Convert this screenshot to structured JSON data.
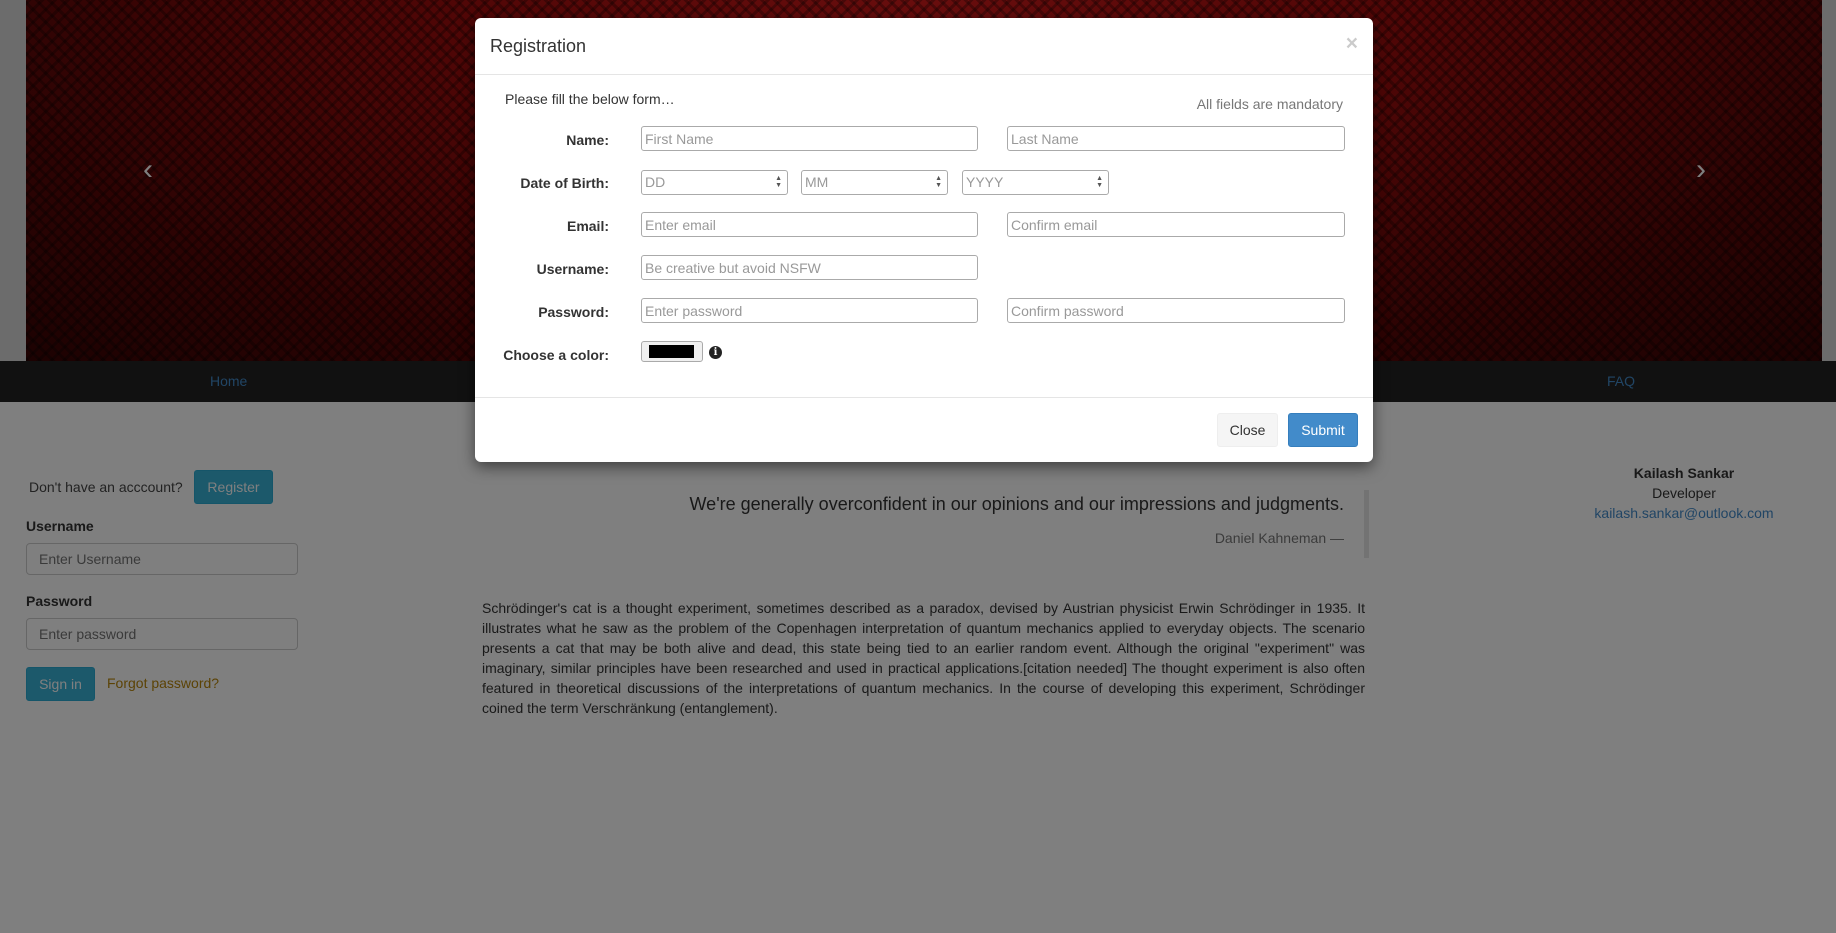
{
  "nav": {
    "home": "Home",
    "faq": "FAQ"
  },
  "carousel": {
    "prev_glyph": "‹",
    "next_glyph": "›"
  },
  "login": {
    "prompt": "Don't have an acccount?",
    "register_label": "Register",
    "username_label": "Username",
    "username_placeholder": "Enter Username",
    "password_label": "Password",
    "password_placeholder": "Enter password",
    "signin_label": "Sign in",
    "forgot_label": "Forgot password?"
  },
  "quote": {
    "text": "We're generally overconfident in our opinions and our impressions and judgments.",
    "author": "Daniel Kahneman —"
  },
  "article": "Schrödinger's cat is a thought experiment, sometimes described as a paradox, devised by Austrian physicist Erwin Schrödinger in 1935. It illustrates what he saw as the problem of the Copenhagen interpretation of quantum mechanics applied to everyday objects. The scenario presents a cat that may be both alive and dead, this state being tied to an earlier random event. Although the original \"experiment\" was imaginary, similar principles have been researched and used in practical applications.[citation needed] The thought experiment is also often featured in theoretical discussions of the interpretations of quantum mechanics. In the course of developing this experiment, Schrödinger coined the term Verschränkung (entanglement).",
  "contact": {
    "name": "Kailash Sankar",
    "role": "Developer",
    "email": "kailash.sankar@outlook.com"
  },
  "modal": {
    "title": "Registration",
    "close_glyph": "×",
    "intro": "Please fill the below form…",
    "note": "All fields are mandatory",
    "labels": {
      "name": "Name:",
      "dob": "Date of Birth:",
      "email": "Email:",
      "username": "Username:",
      "password": "Password:",
      "color": "Choose a color:"
    },
    "placeholders": {
      "first_name": "First Name",
      "last_name": "Last Name",
      "dd": "DD",
      "mm": "MM",
      "yyyy": "YYYY",
      "email": "Enter email",
      "confirm_email": "Confirm email",
      "username": "Be creative but avoid NSFW",
      "password": "Enter password",
      "confirm_password": "Confirm password"
    },
    "color_value": "#000000",
    "info_glyph": "i",
    "spin_glyph_up": "▲",
    "spin_glyph_down": "▼",
    "close_label": "Close",
    "submit_label": "Submit"
  }
}
